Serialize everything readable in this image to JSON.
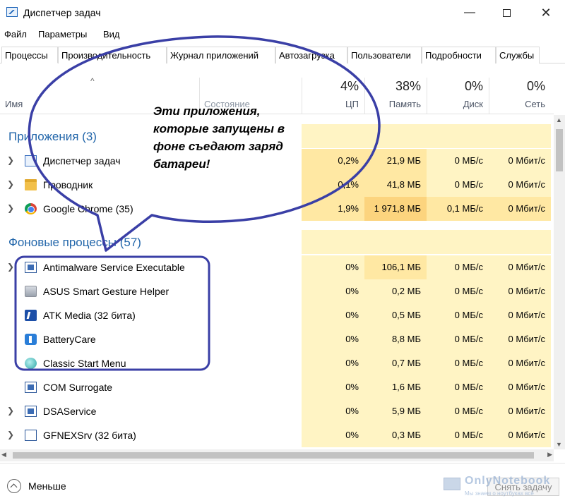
{
  "window": {
    "title": "Диспетчер задач",
    "minimize": "—",
    "close": "✕"
  },
  "menu": [
    "Файл",
    "Параметры",
    "Вид"
  ],
  "tabs": [
    "Процессы",
    "Производительность",
    "Журнал приложений",
    "Автозагрузка",
    "Пользователи",
    "Подробности",
    "Службы"
  ],
  "active_tab": "Процессы",
  "columns": {
    "name": "Имя",
    "status": "Состояние",
    "cpu": {
      "percent": "4%",
      "label": "ЦП"
    },
    "memory": {
      "percent": "38%",
      "label": "Память"
    },
    "disk": {
      "percent": "0%",
      "label": "Диск"
    },
    "network": {
      "percent": "0%",
      "label": "Сеть"
    }
  },
  "groups": [
    {
      "title": "Приложения (3)",
      "items": [
        {
          "name": "Диспетчер задач",
          "icon": "task-manager-icon",
          "cpu": "0,2%",
          "memory": "21,9 МБ",
          "disk": "0 МБ/с",
          "network": "0 Мбит/с"
        },
        {
          "name": "Проводник",
          "icon": "folder-icon",
          "cpu": "0,1%",
          "memory": "41,8 МБ",
          "disk": "0 МБ/с",
          "network": "0 Мбит/с"
        },
        {
          "name": "Google Chrome (35)",
          "icon": "chrome-icon",
          "cpu": "1,9%",
          "memory": "1 971,8 МБ",
          "disk": "0,1 МБ/с",
          "network": "0 Мбит/с"
        }
      ]
    },
    {
      "title": "Фоновые процессы (57)",
      "items": [
        {
          "name": "Antimalware Service Executable",
          "icon": "service-window-icon",
          "cpu": "0%",
          "memory": "106,1 МБ",
          "disk": "0 МБ/с",
          "network": "0 Мбит/с"
        },
        {
          "name": "ASUS Smart Gesture Helper",
          "icon": "asus-gesture-icon",
          "cpu": "0%",
          "memory": "0,2 МБ",
          "disk": "0 МБ/с",
          "network": "0 Мбит/с"
        },
        {
          "name": "ATK Media (32 бита)",
          "icon": "atk-media-icon",
          "cpu": "0%",
          "memory": "0,5 МБ",
          "disk": "0 МБ/с",
          "network": "0 Мбит/с"
        },
        {
          "name": "BatteryCare",
          "icon": "battery-care-icon",
          "cpu": "0%",
          "memory": "8,8 МБ",
          "disk": "0 МБ/с",
          "network": "0 Мбит/с"
        },
        {
          "name": "Classic Start Menu",
          "icon": "classic-start-menu-icon",
          "cpu": "0%",
          "memory": "0,7 МБ",
          "disk": "0 МБ/с",
          "network": "0 Мбит/с"
        },
        {
          "name": "COM Surrogate",
          "icon": "service-window-icon",
          "cpu": "0%",
          "memory": "1,6 МБ",
          "disk": "0 МБ/с",
          "network": "0 Мбит/с"
        },
        {
          "name": "DSAService",
          "icon": "service-window-icon",
          "cpu": "0%",
          "memory": "5,9 МБ",
          "disk": "0 МБ/с",
          "network": "0 Мбит/с"
        },
        {
          "name": "GFNEXSrv (32 бита)",
          "icon": "gfnexsrv-icon",
          "cpu": "0%",
          "memory": "0,3 МБ",
          "disk": "0 МБ/с",
          "network": "0 Мбит/с"
        }
      ]
    }
  ],
  "footer": {
    "less": "Меньше",
    "end_task": "Снять задачу"
  },
  "annotation": {
    "text": "Эти приложения, которые запущены в фоне съедают заряд батареи!",
    "color": "#3a3fa6"
  },
  "watermark": {
    "name": "OnlyNotebook",
    "tagline": "Мы знаем о ноутбуках всё"
  },
  "colors": {
    "heat_light": "#fff4c4",
    "heat_medium": "#ffe8a3",
    "heat_strong": "#fcd47e",
    "group_title": "#2266aa"
  }
}
